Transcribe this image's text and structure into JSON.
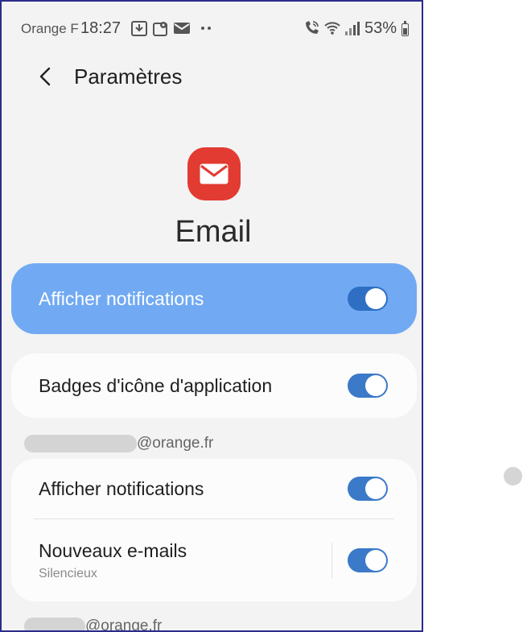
{
  "status_bar": {
    "carrier": "Orange F",
    "time": "18:27",
    "battery": "53%"
  },
  "header": {
    "title": "Paramètres"
  },
  "app": {
    "name": "Email",
    "icon": "mail-icon",
    "icon_color": "#e23b32"
  },
  "main_toggle": {
    "label": "Afficher notifications",
    "on": true
  },
  "badges": {
    "label": "Badges d'icône d'application",
    "on": true
  },
  "accounts": [
    {
      "domain": "@orange.fr",
      "items": [
        {
          "label": "Afficher notifications",
          "sub": "",
          "on": true
        },
        {
          "label": "Nouveaux e-mails",
          "sub": "Silencieux",
          "on": true
        }
      ]
    },
    {
      "domain": "@orange.fr"
    }
  ],
  "colors": {
    "accent": "#3b79c9",
    "highlight": "#71aaf3"
  }
}
